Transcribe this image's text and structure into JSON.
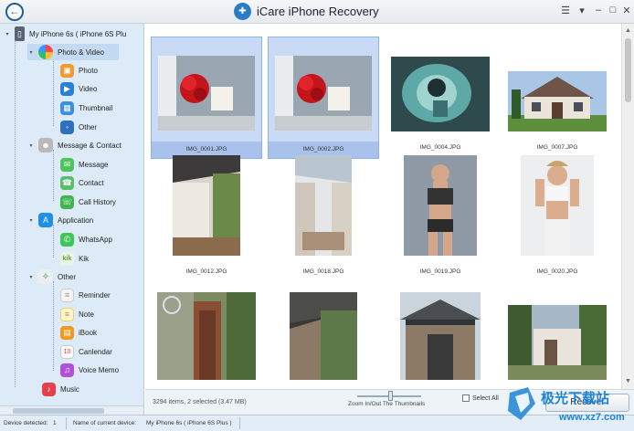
{
  "window": {
    "title": "iCare iPhone Recovery"
  },
  "sidebar": {
    "device": "My iPhone 6s ( iPhone 6S Plu",
    "categories": [
      {
        "label": "Photo & Video",
        "icon": "photos-icon",
        "items": [
          {
            "label": "Photo",
            "icon": "photo-icon"
          },
          {
            "label": "Video",
            "icon": "video-icon"
          },
          {
            "label": "Thumbnail",
            "icon": "thumbnail-icon"
          },
          {
            "label": "Other",
            "icon": "other-icon"
          }
        ]
      },
      {
        "label": "Message & Contact",
        "icon": "contacts-icon",
        "items": [
          {
            "label": "Message",
            "icon": "message-icon"
          },
          {
            "label": "Contact",
            "icon": "contact-icon"
          },
          {
            "label": "Call History",
            "icon": "phone-icon"
          }
        ]
      },
      {
        "label": "Application",
        "icon": "app-store-icon",
        "items": [
          {
            "label": "WhatsApp",
            "icon": "whatsapp-icon"
          },
          {
            "label": "Kik",
            "icon": "kik-icon"
          }
        ]
      },
      {
        "label": "Other",
        "icon": "other-folder-icon",
        "items": [
          {
            "label": "Reminder",
            "icon": "reminder-icon"
          },
          {
            "label": "Note",
            "icon": "note-icon"
          },
          {
            "label": "iBook",
            "icon": "ibook-icon"
          },
          {
            "label": "Canlendar",
            "icon": "calendar-icon"
          },
          {
            "label": "Voice Memo",
            "icon": "voice-memo-icon"
          },
          {
            "label": "Music",
            "icon": "music-icon"
          }
        ]
      }
    ]
  },
  "thumbnails": [
    {
      "name": "IMG_0001.JPG",
      "selected": true
    },
    {
      "name": "IMG_0002.JPG",
      "selected": true
    },
    {
      "name": "IMG_0004.JPG",
      "selected": false
    },
    {
      "name": "IMG_0007.JPG",
      "selected": false
    },
    {
      "name": "IMG_0012.JPG",
      "selected": false
    },
    {
      "name": "IMG_0018.JPG",
      "selected": false
    },
    {
      "name": "IMG_0019.JPG",
      "selected": false
    },
    {
      "name": "IMG_0020.JPG",
      "selected": false
    },
    {
      "name": "",
      "selected": false
    },
    {
      "name": "",
      "selected": false
    },
    {
      "name": "",
      "selected": false
    },
    {
      "name": "",
      "selected": false
    }
  ],
  "actionbar": {
    "count": "3294 items, 2 selected (3.47 MB)",
    "zoom_label": "Zoom In/Out The Thumbnails",
    "select_all": "Select All",
    "recover": "Recover"
  },
  "statusbar": {
    "device_detected_label": "Device detected:",
    "device_detected_value": "1",
    "current_device_label": "Name of current device:",
    "current_device_value": "My iPhone 6s ( iPhone 6S Plus )"
  },
  "watermark": {
    "brand": "极光下载站",
    "url": "www.xz7.com"
  },
  "colors": {
    "accent": "#2b7cc4",
    "sidebar_bg": "#dcebf7",
    "selection": "#c8daf6"
  }
}
